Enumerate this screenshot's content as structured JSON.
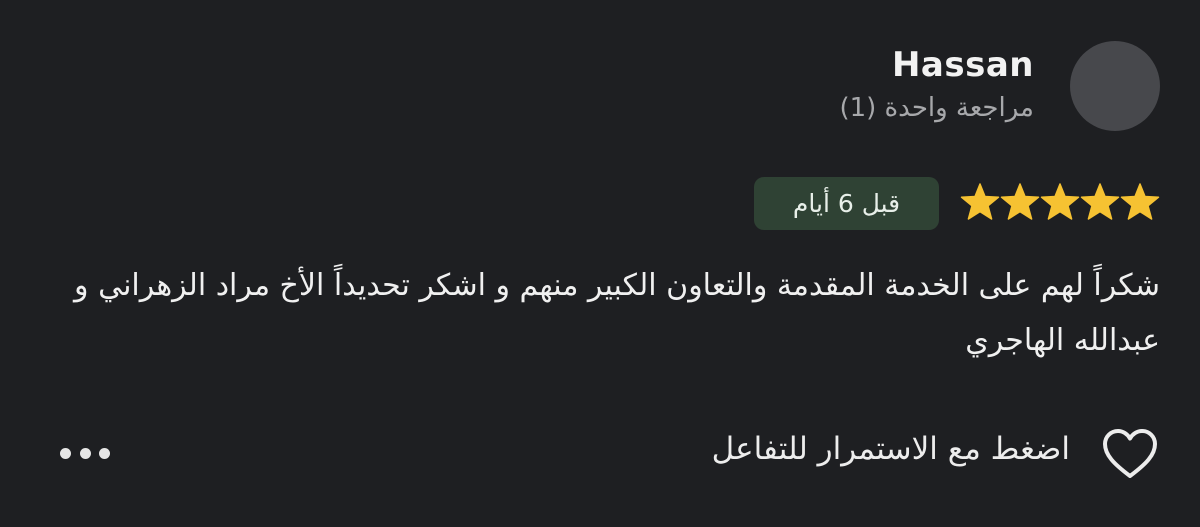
{
  "review": {
    "author_name": "Hassan",
    "review_count_label": "مراجعة واحدة (1)",
    "rating": 5,
    "rating_max": 5,
    "time_ago": "قبل 6 أيام",
    "text": "شكراً لهم على الخدمة المقدمة والتعاون الكبير منهم و اشكر تحديداً الأخ مراد الزهراني و عبدالله الهاجري"
  },
  "actions": {
    "like_label": "اضغط مع الاستمرار للتفاعل",
    "like_icon": "heart-outline-icon",
    "more_icon": "more-horizontal-icon"
  },
  "colors": {
    "background": "#1e1f22",
    "star": "#f6c232",
    "badge_background": "#2f4234",
    "secondary_text": "#a7a8ab",
    "avatar_placeholder": "#47484c"
  }
}
